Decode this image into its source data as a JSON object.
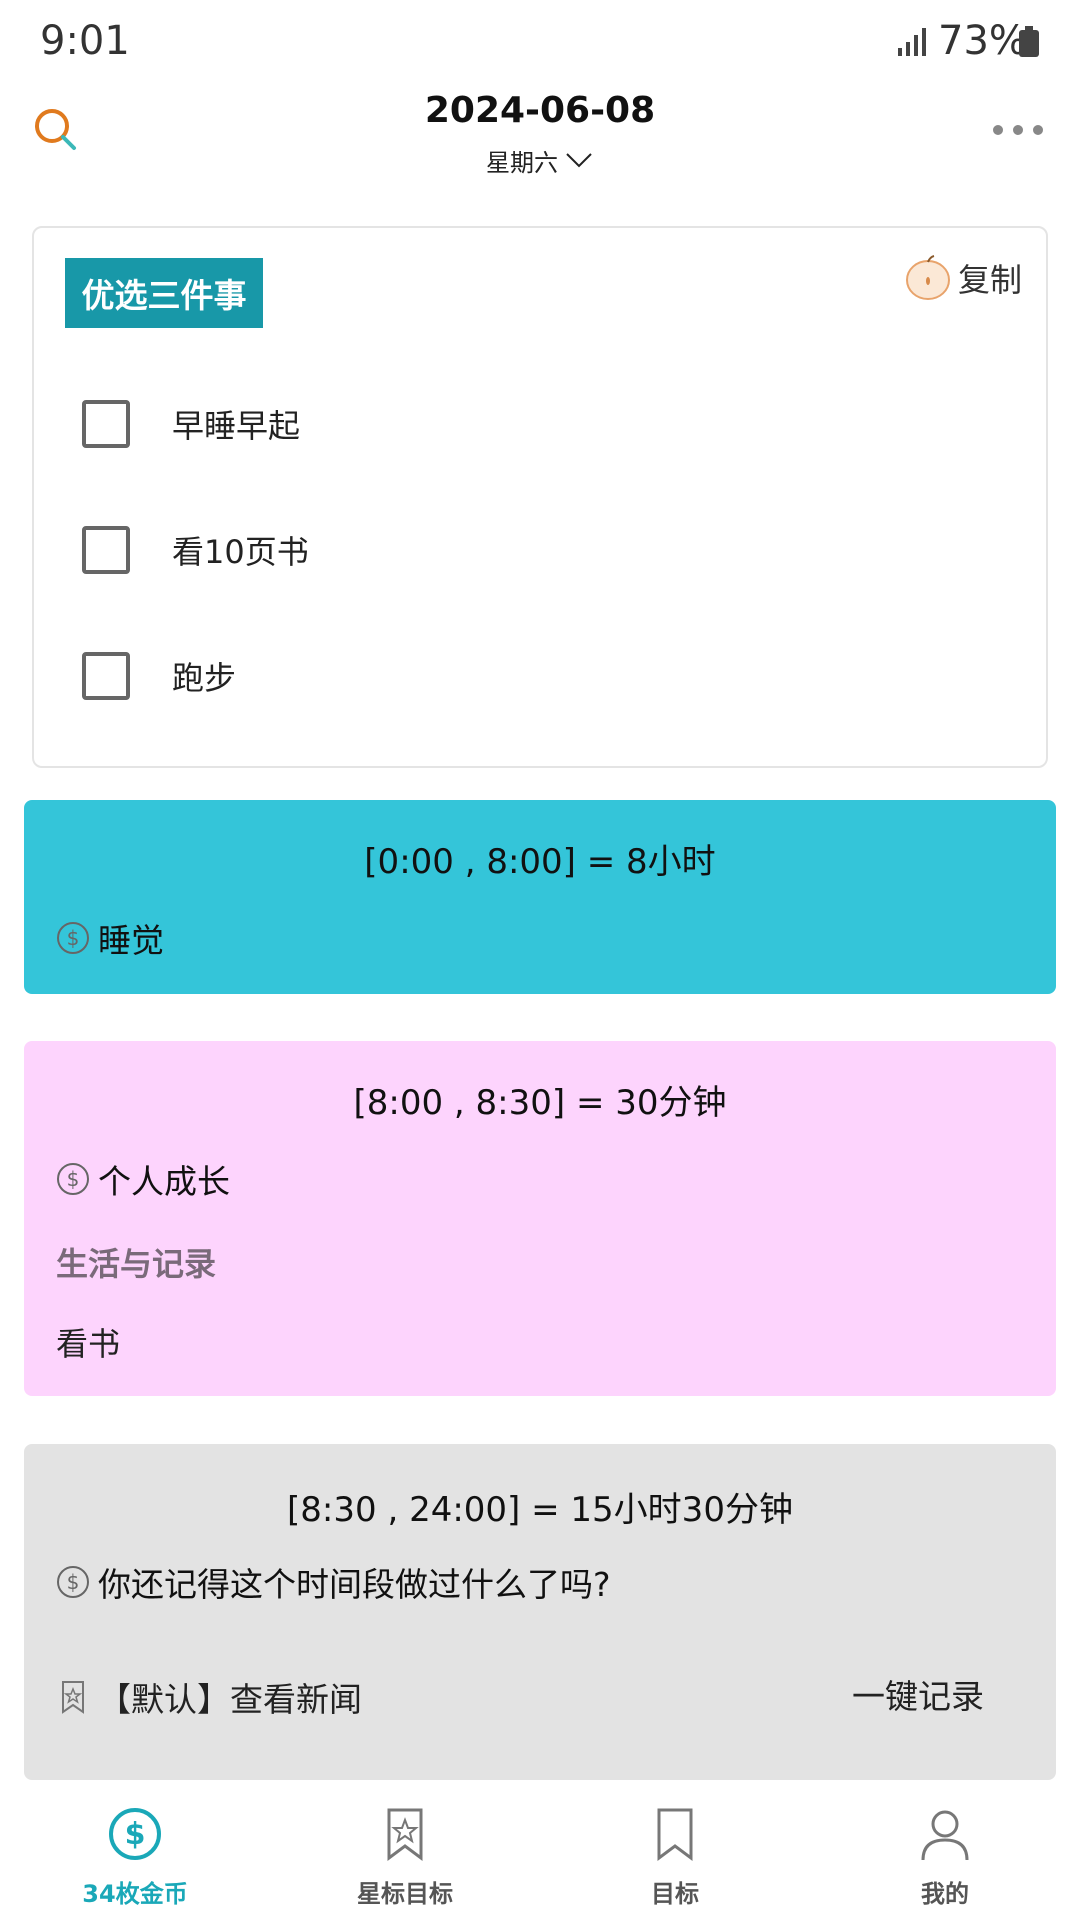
{
  "status_bar": {
    "time": "9:01",
    "battery": "73%"
  },
  "header": {
    "date": "2024-06-08",
    "weekday": "星期六"
  },
  "top_three": {
    "title": "优选三件事",
    "copy_label": "复制",
    "tasks": [
      {
        "label": "早睡早起",
        "checked": false
      },
      {
        "label": "看10页书",
        "checked": false
      },
      {
        "label": "跑步",
        "checked": false
      }
    ]
  },
  "time_blocks": [
    {
      "range": "[0:00 , 8:00] = 8小时",
      "category": "睡觉",
      "color": "#34c5d9"
    },
    {
      "range": "[8:00 , 8:30] = 30分钟",
      "category": "个人成长",
      "sub_category": "生活与记录",
      "activity": "看书",
      "color": "#fdd4fd"
    },
    {
      "range": "[8:30 , 24:00] = 15小时30分钟",
      "category": "你还记得这个时间段做过什么了吗?",
      "default_label": "【默认】查看新闻",
      "quick_record": "一键记录",
      "color": "#e3e3e3"
    }
  ],
  "bottom_nav": [
    {
      "label": "34枚金币",
      "icon": "dollar-coin-icon",
      "active": true
    },
    {
      "label": "星标目标",
      "icon": "star-bookmark-icon",
      "active": false
    },
    {
      "label": "目标",
      "icon": "bookmark-icon",
      "active": false
    },
    {
      "label": "我的",
      "icon": "person-icon",
      "active": false
    }
  ],
  "colors": {
    "accent": "#1aa8b8",
    "tag": "#1898a8"
  }
}
